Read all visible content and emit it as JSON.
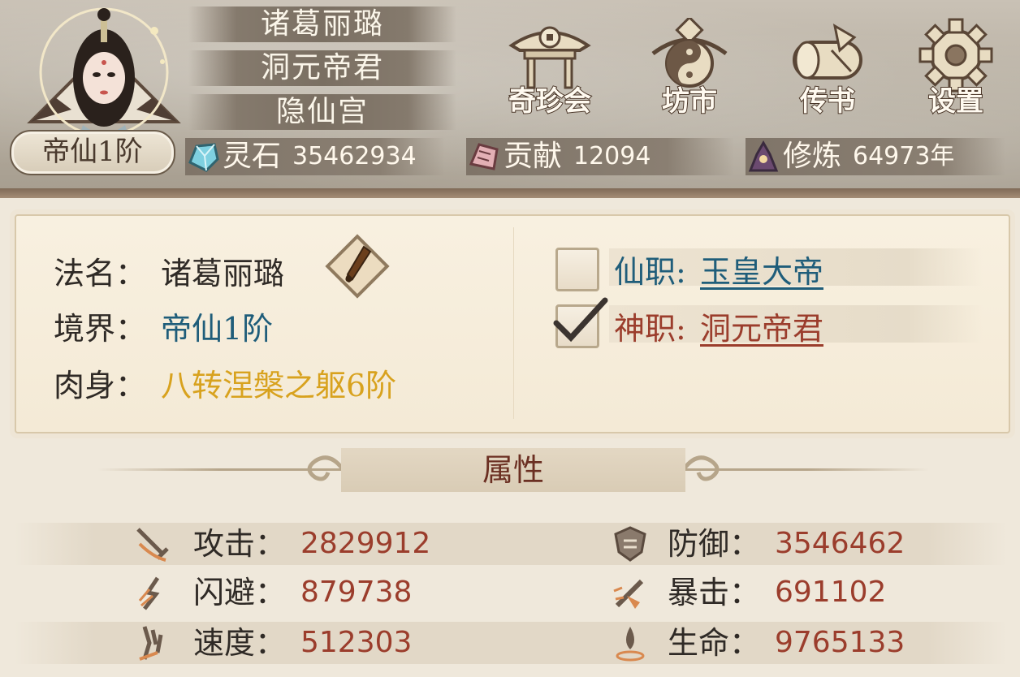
{
  "profile": {
    "rank_badge": "帝仙1阶",
    "name_lines": [
      "诸葛丽璐",
      "洞元帝君",
      "隐仙宫"
    ]
  },
  "menu": [
    {
      "label": "奇珍会",
      "icon": "pavilion-icon"
    },
    {
      "label": "坊市",
      "icon": "taiji-shop-icon"
    },
    {
      "label": "传书",
      "icon": "scroll-icon"
    },
    {
      "label": "设置",
      "icon": "gear-icon"
    }
  ],
  "resources": [
    {
      "name": "灵石",
      "value": "35462934",
      "icon": "spirit-stone-icon"
    },
    {
      "name": "贡献",
      "value": "12094",
      "icon": "contribution-icon"
    },
    {
      "name": "修炼",
      "value": "64973年",
      "icon": "cultivation-icon"
    }
  ],
  "info": {
    "dharma_name_label": "法名：",
    "dharma_name": "诸葛丽璐",
    "realm_label": "境界：",
    "realm": "帝仙1阶",
    "body_label": "肉身：",
    "body": "八转涅槃之躯6阶",
    "immortal_post_label": "仙职:",
    "immortal_post": "玉皇大帝",
    "divine_post_label": "神职:",
    "divine_post": "洞元帝君",
    "immortal_post_checked": false,
    "divine_post_checked": true
  },
  "attributes": {
    "title": "属性",
    "stats": [
      {
        "label": "攻击：",
        "value": "2829912",
        "icon": "sword-attack-icon"
      },
      {
        "label": "防御：",
        "value": "3546462",
        "icon": "shield-defense-icon"
      },
      {
        "label": "闪避：",
        "value": "879738",
        "icon": "dodge-icon"
      },
      {
        "label": "暴击：",
        "value": "691102",
        "icon": "critical-icon"
      },
      {
        "label": "速度：",
        "value": "512303",
        "icon": "speed-icon"
      },
      {
        "label": "生命：",
        "value": "9765133",
        "icon": "life-icon"
      }
    ]
  },
  "colors": {
    "realm": "#1f5d7a",
    "body": "#d8a21e",
    "immortal_post": "#1f5d7a",
    "divine_post": "#9b3d2c",
    "stat_value": "#9b3d2c",
    "attr_title": "#6b2f22"
  }
}
